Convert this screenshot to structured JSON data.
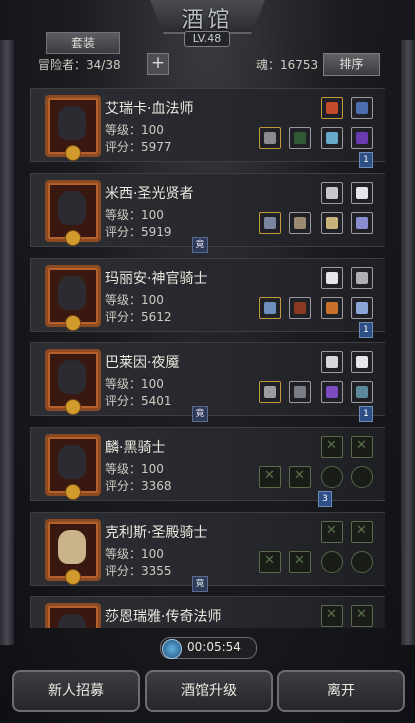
{
  "header": {
    "title": "酒馆",
    "level": "LV.48",
    "tab_suit": "套装",
    "adventurers": "冒险者：34/38",
    "add_symbol": "+",
    "soul": "魂：16753",
    "sort_label": "排序"
  },
  "heroes": [
    {
      "name": "艾瑞卡·血法师",
      "level": "等级：100",
      "score": "评分：5977"
    },
    {
      "name": "米西·圣光贤者",
      "level": "等级：100",
      "score": "评分：5919"
    },
    {
      "name": "玛丽安·神官骑士",
      "level": "等级：100",
      "score": "评分：5612"
    },
    {
      "name": "巴莱因·夜魇",
      "level": "等级：100",
      "score": "评分：5401"
    },
    {
      "name": "麟·黑骑士",
      "level": "等级：100",
      "score": "评分：3368"
    },
    {
      "name": "克利斯·圣殿骑士",
      "level": "等级：100",
      "score": "评分：3355"
    },
    {
      "name": "莎恩瑞雅·传奇法师",
      "level": "",
      "score": ""
    }
  ],
  "tags": {
    "one": "1",
    "three": "3",
    "jing": "竟"
  },
  "timer": "00:05:54",
  "bottom": {
    "recruit": "新人招募",
    "upgrade": "酒馆升级",
    "leave": "离开"
  },
  "colors": {
    "frame": "#2a2b30",
    "card": "#2d2e33",
    "portrait_border": "#8c4a22",
    "tag_blue": "#2d4f86"
  }
}
